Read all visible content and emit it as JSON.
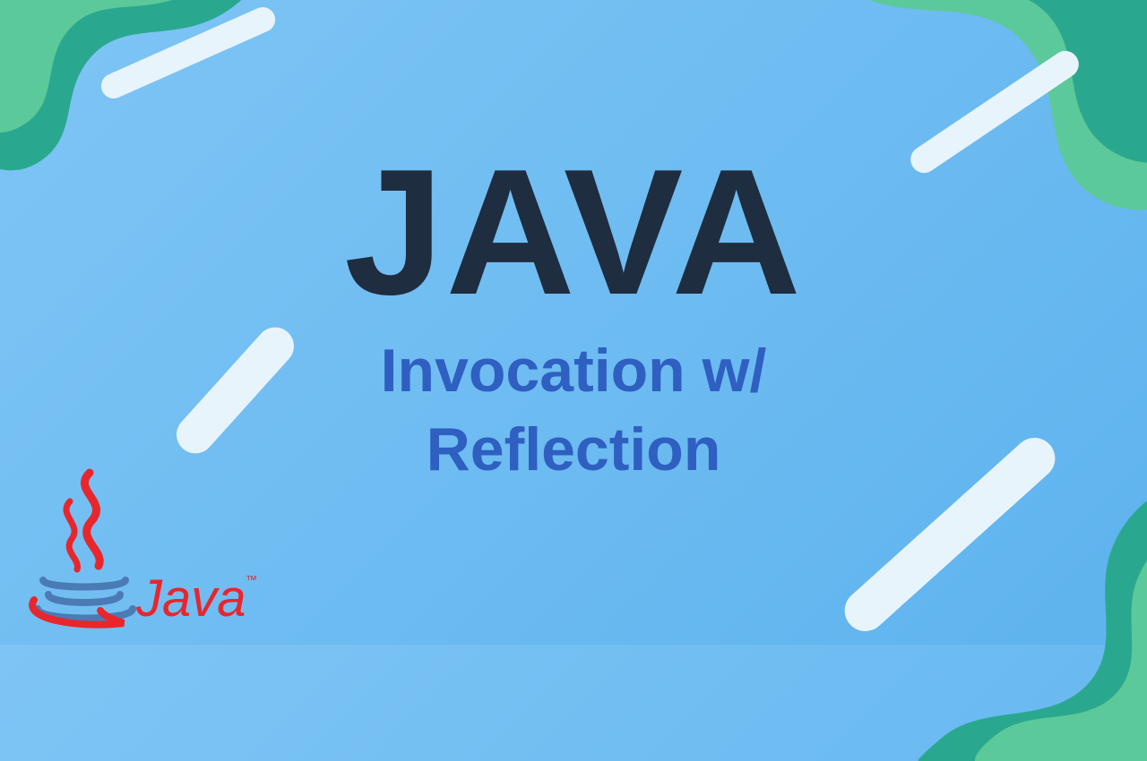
{
  "title": "JAVA",
  "subtitle_line1": "Invocation w/",
  "subtitle_line2": "Reflection",
  "logo_text": "Java",
  "colors": {
    "bg_top": "#7ec5f5",
    "bg_bottom": "#5eb3ee",
    "title": "#1e2d3f",
    "subtitle": "#2e5fc1",
    "blob_teal": "#2aa88f",
    "blob_green": "#5cc99a",
    "pill": "#e8f4fb",
    "java_red": "#e8262b",
    "java_blue": "#4a7bb5"
  }
}
